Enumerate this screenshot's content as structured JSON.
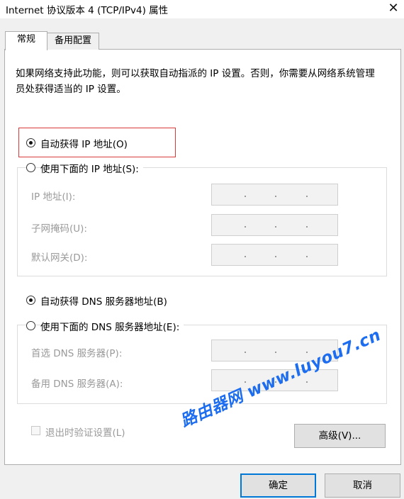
{
  "window": {
    "title": "Internet 协议版本 4 (TCP/IPv4) 属性",
    "close_glyph": "✕"
  },
  "tabs": [
    {
      "label": "常规"
    },
    {
      "label": "备用配置"
    }
  ],
  "description": "如果网络支持此功能，则可以获取自动指派的 IP 设置。否则，你需要从网络系统管理员处获得适当的 IP 设置。",
  "ip": {
    "auto_label": "自动获得 IP 地址(O)",
    "manual_label": "使用下面的 IP 地址(S):",
    "selected": "auto",
    "fields": [
      {
        "label": "IP 地址(I):",
        "value": ""
      },
      {
        "label": "子网掩码(U):",
        "value": ""
      },
      {
        "label": "默认网关(D):",
        "value": ""
      }
    ]
  },
  "dns": {
    "auto_label": "自动获得 DNS 服务器地址(B)",
    "manual_label": "使用下面的 DNS 服务器地址(E):",
    "selected": "auto",
    "fields": [
      {
        "label": "首选 DNS 服务器(P):",
        "value": ""
      },
      {
        "label": "备用 DNS 服务器(A):",
        "value": ""
      }
    ]
  },
  "validate_label": "退出时验证设置(L)",
  "validate_checked": false,
  "advanced_button": "高级(V)...",
  "ok_button": "确定",
  "cancel_button": "取消",
  "watermark": "路由器网 www.luyou7.cn",
  "colors": {
    "accent": "#0078d7",
    "highlight_box": "#d93a3a",
    "watermark": "#1d6df0"
  }
}
